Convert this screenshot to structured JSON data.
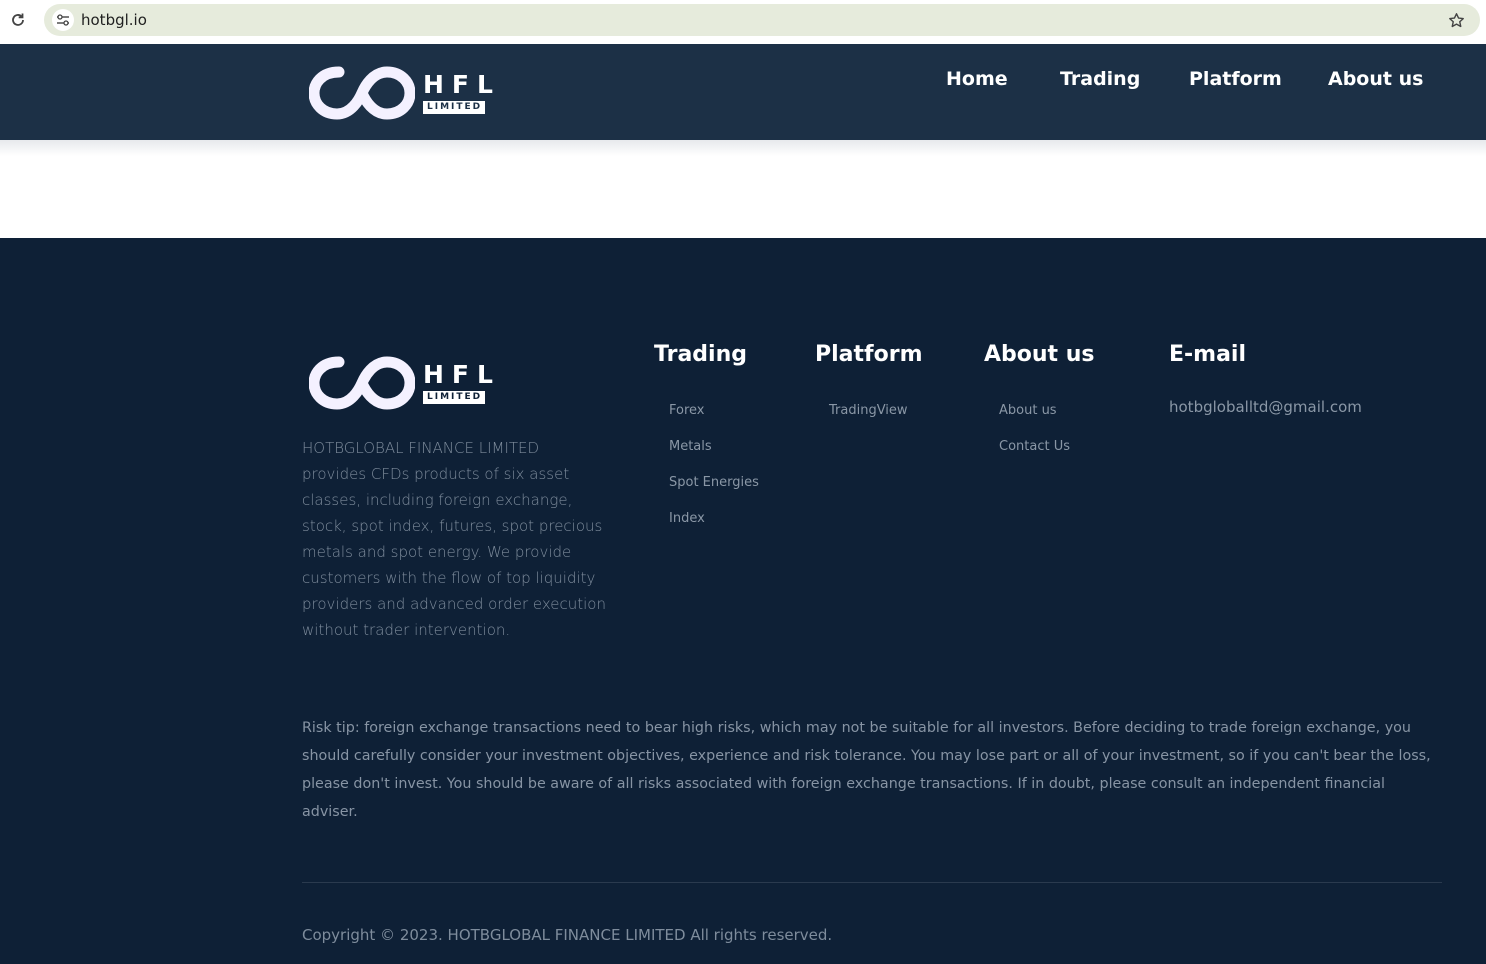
{
  "browser": {
    "url": "hotbgl.io"
  },
  "header": {
    "logo_text": "HFL",
    "logo_subtext": "LIMITED",
    "nav": [
      {
        "label": "Home"
      },
      {
        "label": "Trading"
      },
      {
        "label": "Platform"
      },
      {
        "label": "About us"
      }
    ]
  },
  "footer": {
    "logo_text": "HFL",
    "logo_subtext": "LIMITED",
    "description": "HOTBGLOBAL FINANCE LIMITED provides CFDs products of six asset classes, including foreign exchange, stock, spot index, futures, spot precious metals and spot energy. We provide customers with the flow of top liquidity providers and advanced order execution without trader intervention.",
    "columns": [
      {
        "title": "Trading",
        "links": [
          "Forex",
          "Metals",
          "Spot Energies",
          "Index"
        ]
      },
      {
        "title": "Platform",
        "links": [
          "TradingView"
        ]
      },
      {
        "title": "About us",
        "links": [
          "About us",
          "Contact Us"
        ]
      },
      {
        "title": "E-mail",
        "links": []
      }
    ],
    "email": "hotbgloballtd@gmail.com",
    "risk_tip": "Risk tip: foreign exchange transactions need to bear high risks, which may not be suitable for all investors. Before deciding to trade foreign exchange, you should carefully consider your investment objectives, experience and risk tolerance. You may lose part or all of your investment, so if you can't bear the loss, please don't invest. You should be aware of all risks associated with foreign exchange transactions. If in doubt, please consult an independent financial adviser.",
    "copyright": "Copyright © 2023. HOTBGLOBAL FINANCE LIMITED All rights reserved."
  },
  "colors": {
    "header_bg": "#1c3046",
    "footer_bg": "#0e2036",
    "omnibox_bg": "#e6ebdc"
  }
}
